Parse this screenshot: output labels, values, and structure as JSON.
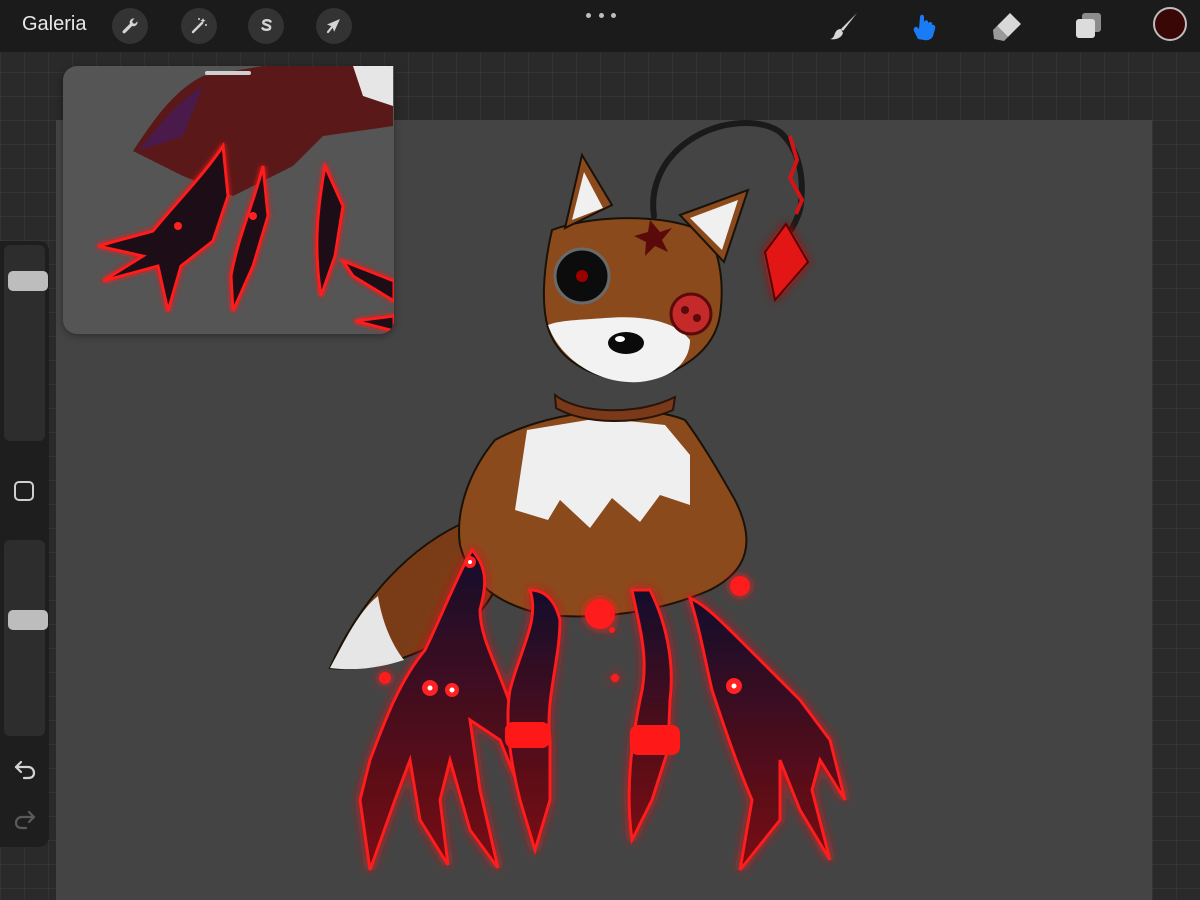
{
  "toolbar": {
    "gallery_label": "Galeria",
    "actions_icon": "wrench-icon",
    "adjustments_icon": "magic-wand-icon",
    "selection_icon": "selection-s-icon",
    "transform_icon": "arrow-cursor-icon",
    "more_icon": "three-dots-icon",
    "brush_icon": "brush-icon",
    "smudge_icon": "smudge-finger-icon",
    "eraser_icon": "eraser-icon",
    "layers_icon": "layers-icon",
    "active_tool": "smudge",
    "active_color": "#3a0707",
    "accent_color": "#1a7cf5"
  },
  "sidebar": {
    "brush_size_level": 0.85,
    "opacity_level": 0.6,
    "modify_icon": "square-modify-icon",
    "undo_icon": "undo-arrow-icon",
    "redo_icon": "redo-arrow-icon"
  },
  "colors": {
    "canvas_background": "#444444",
    "fur": "#8a4a1c",
    "glow": "#ff1a1a",
    "claws": "#170a2a"
  }
}
